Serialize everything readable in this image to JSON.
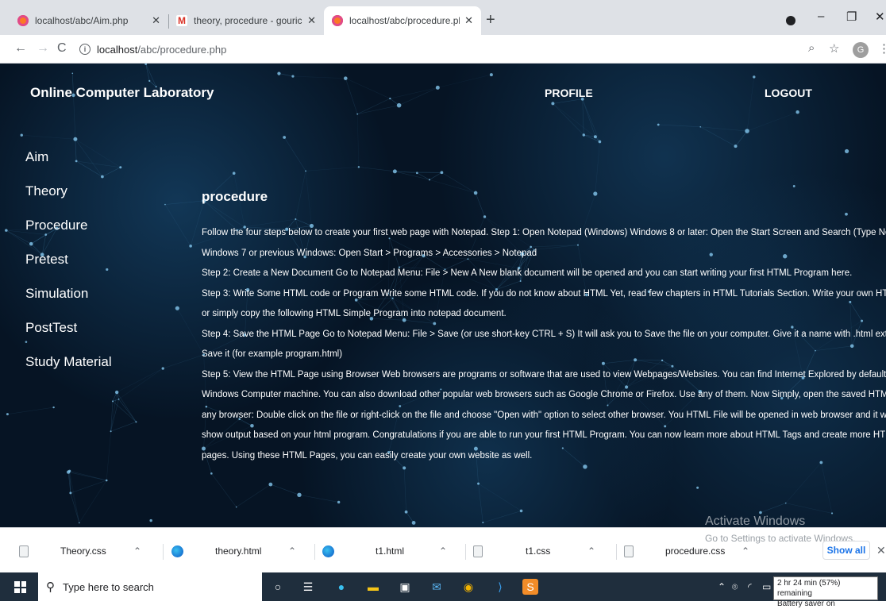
{
  "browser": {
    "tabs": [
      {
        "title": "localhost/abc/Aim.php",
        "icon": "xampp-icon",
        "active": false
      },
      {
        "title": "theory, procedure - gourichandg",
        "icon": "gmail-icon",
        "active": false
      },
      {
        "title": "localhost/abc/procedure.php",
        "icon": "xampp-icon",
        "active": true
      }
    ],
    "new_tab": "+",
    "address_host": "localhost",
    "address_path": "/abc/procedure.php",
    "avatar_letter": "G"
  },
  "site": {
    "title": "Online Computer Laboratory",
    "nav": {
      "profile": "PROFILE",
      "logout": "LOGOUT"
    },
    "sidebar": [
      "Aim",
      "Theory",
      "Procedure",
      "Pretest",
      "Simulation",
      "PostTest",
      "Study Material"
    ]
  },
  "procedure": {
    "heading": "procedure",
    "lines": [
      "Follow the four steps below to create your first web page with Notepad. Step 1: Open Notepad (Windows) Windows 8 or later: Open the Start Screen and Search (Type Notepad)",
      "Windows 7 or previous Windows: Open Start > Programs > Accessories > Notepad",
      "Step 2: Create a New Document Go to Notepad Menu: File > New A New blank document will be opened and you can start writing your first HTML Program here.",
      "Step 3: Write Some HTML code or Program Write some HTML code. If you do not know about HTML Yet, read few chapters in HTML Tutorials Section. Write your own HTML code",
      "or simply copy the following HTML Simple Program into notepad document.",
      "Step 4: Save the HTML Page Go to Notepad Menu: File > Save (or use short-key CTRL + S) It will ask you to Save the file on your computer. Give it a name with .html extension and",
      "Save it (for example program.html)",
      "Step 5: View the HTML Page using Browser Web browsers are programs or software that are used to view Webpages/Websites. You can find Internet Explored by default if using",
      "Windows Computer machine. You can also download other popular web browsers such as Google Chrome or Firefox. Use any of them. Now Simply, open the saved HTML file in",
      "any browser: Double click on the file or right-click on the file and choose \"Open with\" option to select other browser. You HTML File will be opened in web browser and it will",
      "show output based on your html program. Congratulations if you are able to run your first HTML Program. You can now learn more about HTML Tags and create more HTML web",
      "pages. Using these HTML Pages, you can easily create your own website as well."
    ]
  },
  "watermark": {
    "line1": "Activate Windows",
    "line2": "Go to Settings to activate Windows."
  },
  "downloads": {
    "items": [
      {
        "name": "Theory.css",
        "icon": "file-icon"
      },
      {
        "name": "theory.html",
        "icon": "edge-icon"
      },
      {
        "name": "t1.html",
        "icon": "edge-icon"
      },
      {
        "name": "t1.css",
        "icon": "file-icon"
      },
      {
        "name": "procedure.css",
        "icon": "file-icon"
      }
    ],
    "show_all": "Show all"
  },
  "taskbar": {
    "search_placeholder": "Type here to search",
    "battery_line1": "2 hr 24 min (57%) remaining",
    "battery_line2": "Battery saver on"
  }
}
